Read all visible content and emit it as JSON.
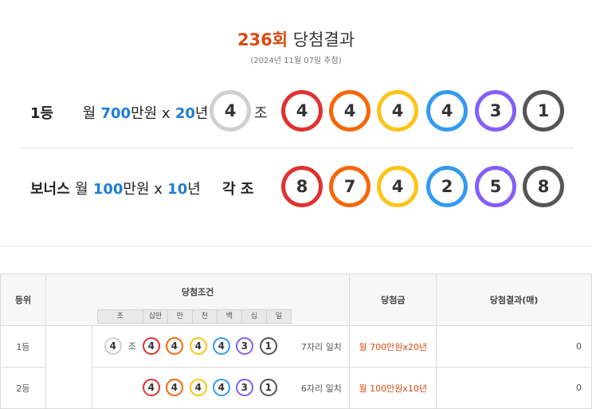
{
  "header": {
    "round": "236회",
    "title_suffix": "당첨결과",
    "date": "(2024년 11월 07일 추첨)"
  },
  "first": {
    "rank": "1등",
    "prize_prefix": "월",
    "amount": "700",
    "unit": "만원 x",
    "years": "20",
    "year_unit": "년",
    "group": "4",
    "jo": "조",
    "numbers": [
      "4",
      "4",
      "4",
      "4",
      "3",
      "1"
    ]
  },
  "bonus": {
    "rank": "보너스",
    "prize_prefix": "월",
    "amount": "100",
    "unit": "만원 x",
    "years": "10",
    "year_unit": "년",
    "group_label": "각 조",
    "numbers": [
      "8",
      "7",
      "4",
      "2",
      "5",
      "8"
    ]
  },
  "table": {
    "headers": {
      "rank": "등위",
      "condition": "당첨조건",
      "prize": "당첨금",
      "result": "당첨결과(매)"
    },
    "sub_headers": [
      "조",
      "십만",
      "만",
      "천",
      "백",
      "십",
      "일"
    ],
    "rows": [
      {
        "rank": "1등",
        "group": "4",
        "jo": "조",
        "numbers": [
          "4",
          "4",
          "4",
          "4",
          "3",
          "1"
        ],
        "match": "7자리 일치",
        "prize": "월 700만원x20년",
        "count": "0"
      },
      {
        "rank": "2등",
        "numbers": [
          "4",
          "4",
          "4",
          "4",
          "3",
          "1"
        ],
        "match": "6자리 일치",
        "prize": "월 100만원x10년",
        "count": "0"
      }
    ]
  },
  "colors": {
    "accent": "#d9480f",
    "highlight": "#1c7ed6",
    "ball_1": "#e03131",
    "ball_2": "#f76707",
    "ball_3": "#fcc419",
    "ball_4": "#339af0",
    "ball_5": "#845ef7",
    "ball_6": "#555555"
  }
}
